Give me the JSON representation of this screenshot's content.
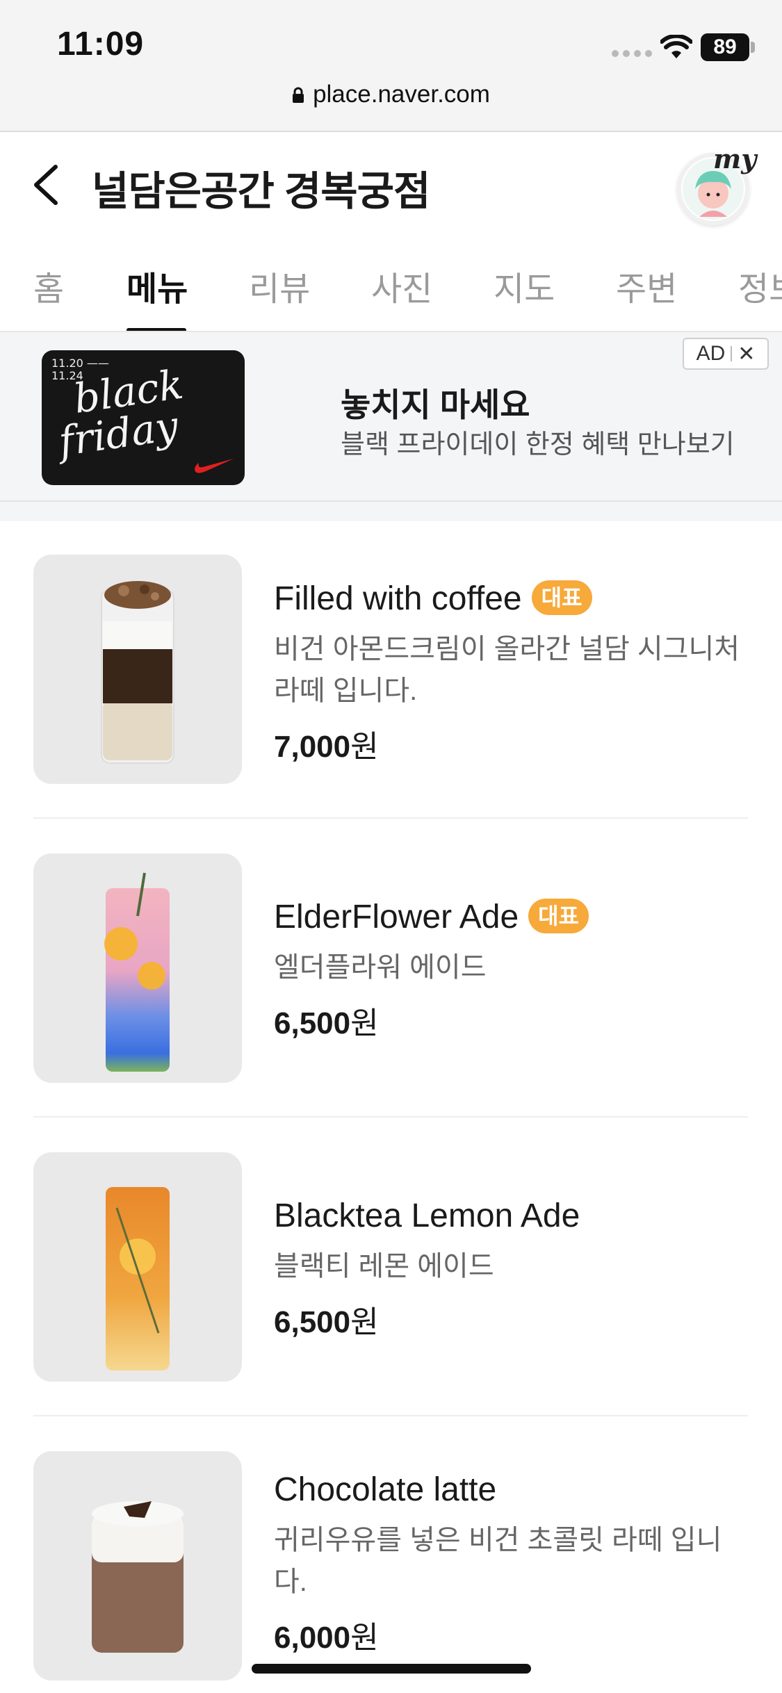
{
  "status_bar": {
    "time": "11:09",
    "battery": "89"
  },
  "browser": {
    "url": "place.naver.com"
  },
  "header": {
    "title": "널담은공간 경복궁점",
    "avatar_label": "my"
  },
  "tabs": [
    {
      "label": "홈",
      "active": false
    },
    {
      "label": "메뉴",
      "active": true
    },
    {
      "label": "리뷰",
      "active": false
    },
    {
      "label": "사진",
      "active": false
    },
    {
      "label": "지도",
      "active": false
    },
    {
      "label": "주변",
      "active": false
    },
    {
      "label": "정보",
      "active": false
    }
  ],
  "ad": {
    "image_date_top": "11.20 ——",
    "image_date_bottom": "11.24",
    "image_text_line1": "black",
    "image_text_line2": "friday",
    "heading": "놓치지 마세요",
    "subtext": "블랙 프라이데이 한정 혜택 만나보기",
    "badge": "AD",
    "close": "✕"
  },
  "menu_items": [
    {
      "name": "Filled with coffee",
      "badge": "대표",
      "description": "비건 아몬드크림이 올라간 널담 시그니처 라떼 입니다.",
      "price": "7,000",
      "currency": "원"
    },
    {
      "name": "ElderFlower Ade",
      "badge": "대표",
      "description": "엘더플라워 에이드",
      "price": "6,500",
      "currency": "원"
    },
    {
      "name": "Blacktea Lemon Ade",
      "badge": "",
      "description": "블랙티 레몬 에이드",
      "price": "6,500",
      "currency": "원"
    },
    {
      "name": "Chocolate latte",
      "badge": "",
      "description": "귀리우유를 넣은 비건 초콜릿 라떼 입니다.",
      "price": "6,000",
      "currency": "원"
    }
  ],
  "colors": {
    "badge_bg": "#f7a93a",
    "ad_bg": "#f4f5f7",
    "active_tab": "#111111",
    "inactive_tab": "#9a9a9a"
  }
}
